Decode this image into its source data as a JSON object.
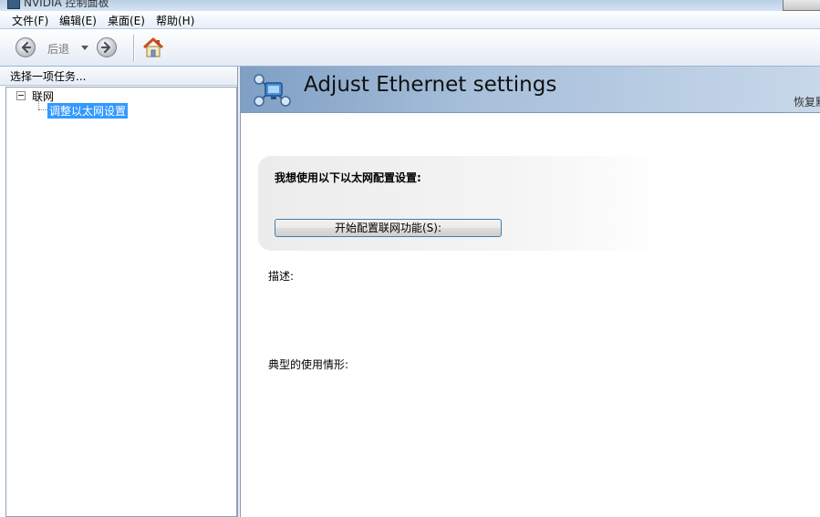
{
  "window": {
    "title": "NVIDIA 控制面板"
  },
  "menubar": {
    "items": [
      "文件(F)",
      "编辑(E)",
      "桌面(E)",
      "帮助(H)"
    ]
  },
  "toolbar": {
    "back_label": "后退"
  },
  "left_pane": {
    "header": "选择一项任务...",
    "tree": {
      "root_label": "联网",
      "child_label": "调整以太网设置"
    }
  },
  "main": {
    "title": "Adjust Ethernet settings",
    "restore_link": "恢复默认",
    "panel_label": "我想使用以下以太网配置设置:",
    "config_button_label": "开始配置联网功能(S):",
    "description_label": "描述:",
    "usage_label": "典型的使用情形:"
  },
  "colors": {
    "banner": "#a7bfda",
    "selection": "#3399ff",
    "button_border": "#3c7fb1"
  }
}
